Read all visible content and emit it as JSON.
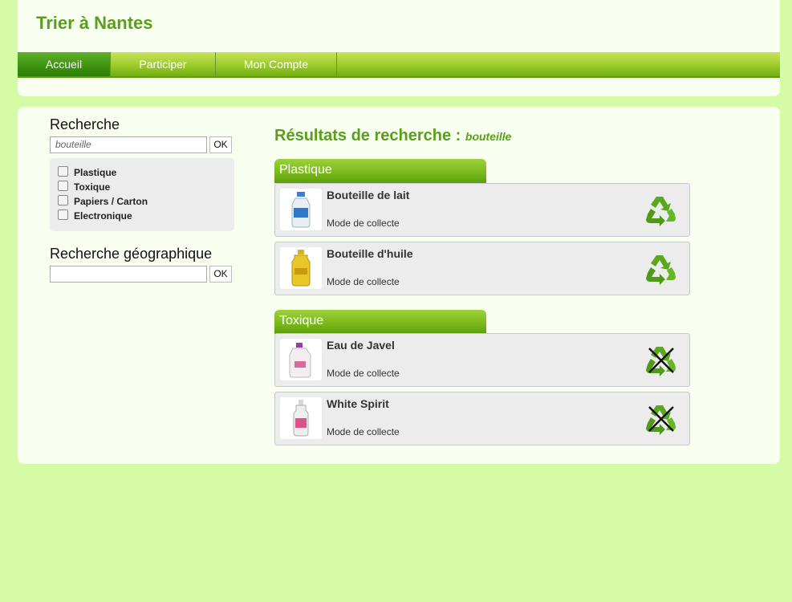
{
  "site": {
    "title": "Trier à Nantes"
  },
  "nav": {
    "items": [
      {
        "label": "Accueil",
        "active": true
      },
      {
        "label": "Participer",
        "active": false
      },
      {
        "label": "Mon Compte",
        "active": false
      }
    ]
  },
  "sidebar": {
    "search": {
      "label": "Recherche",
      "value": "bouteille",
      "ok_label": "OK"
    },
    "filters": [
      "Plastique",
      "Toxique",
      "Papiers / Carton",
      "Electronique"
    ],
    "geo_search": {
      "label": "Recherche géographique",
      "value": "",
      "ok_label": "OK"
    }
  },
  "results": {
    "title": "Résultats de recherche :",
    "query": "bouteille",
    "categories": [
      {
        "name": "Plastique",
        "items": [
          {
            "name": "Bouteille de lait",
            "mode": "Mode de collecte",
            "recyclable": true,
            "icon": "milk-bottle-icon"
          },
          {
            "name": "Bouteille d'huile",
            "mode": "Mode de collecte",
            "recyclable": true,
            "icon": "oil-bottle-icon"
          }
        ]
      },
      {
        "name": "Toxique",
        "items": [
          {
            "name": "Eau de Javel",
            "mode": "Mode de collecte",
            "recyclable": false,
            "icon": "bleach-bottle-icon"
          },
          {
            "name": "White Spirit",
            "mode": "Mode de collecte",
            "recyclable": false,
            "icon": "white-spirit-bottle-icon"
          }
        ]
      }
    ]
  },
  "colors": {
    "page_bg": "#d6fba6",
    "panel_bg": "#f8fff0",
    "accent": "#5a9e1c",
    "recycle_green": "#5aa81e"
  }
}
